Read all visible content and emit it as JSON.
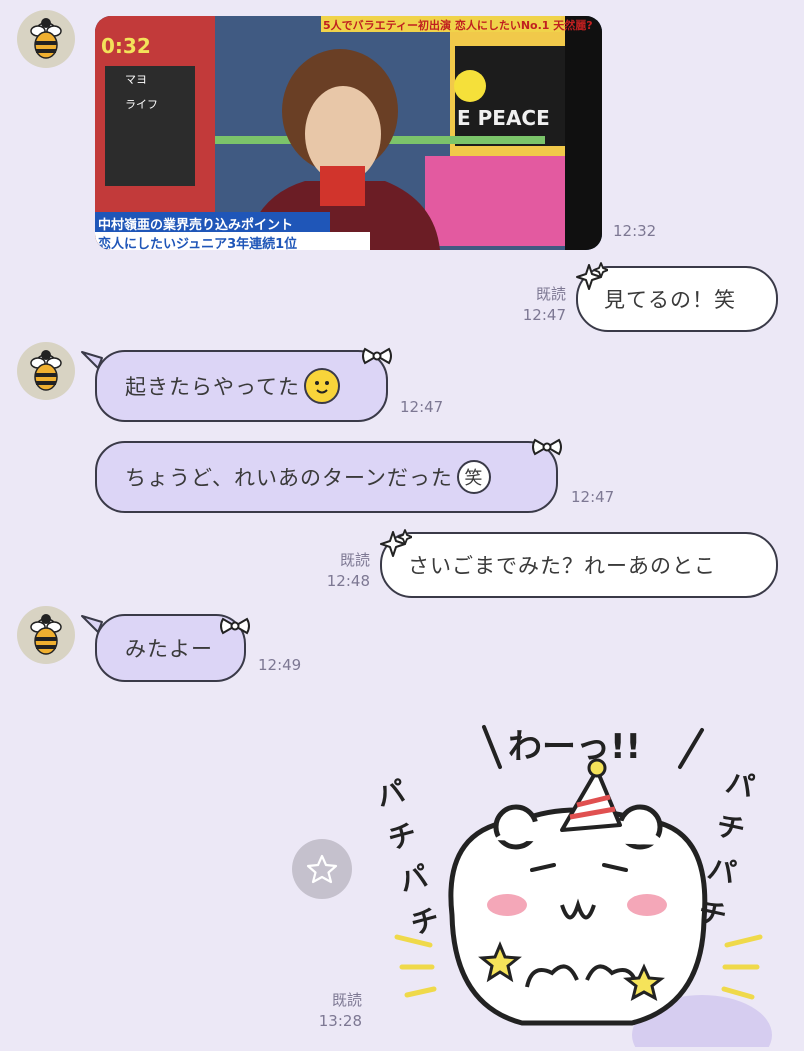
{
  "messages": [
    {
      "type": "image",
      "time": "12:32",
      "overlay": {
        "clock": "0:32",
        "banner_top": "5人でバラエティー初出演 恋人にしたいNo.1 天然麗?",
        "caption1": "中村嶺亜の業界売り込みポイント",
        "caption2": "恋人にしたいジュニア3年連続1位",
        "sign": "E PEACE",
        "side_labels": [
          "マヨ",
          "ライフ"
        ]
      }
    },
    {
      "type": "out",
      "read": "既読",
      "time": "12:47",
      "text": "見てるの！笑"
    },
    {
      "type": "in",
      "time": "12:47",
      "text": "起きたらやってた",
      "emoji": "happy-face-emoji"
    },
    {
      "type": "in",
      "time": "12:47",
      "text": "ちょうど、れいあのターンだった",
      "emoji": "笑"
    },
    {
      "type": "out",
      "read": "既読",
      "time": "12:48",
      "text": "さいごまでみた？れーあのとこ"
    },
    {
      "type": "in",
      "time": "12:49",
      "text": "みたよー"
    },
    {
      "type": "sticker",
      "read": "既読",
      "time": "13:28",
      "sticker_text": {
        "top": "わーっ!!",
        "left": "パチパチ",
        "right": "パチパチ"
      }
    }
  ],
  "icons": {
    "avatar": "bee-avatar-icon",
    "favorite": "star-icon",
    "bow": "bow-icon",
    "sparkle": "sparkle-icon"
  },
  "colors": {
    "background": "#ece8f6",
    "bubble_in": "#dcd5f6",
    "bubble_out": "#ffffff",
    "outline": "#3a3a48"
  }
}
